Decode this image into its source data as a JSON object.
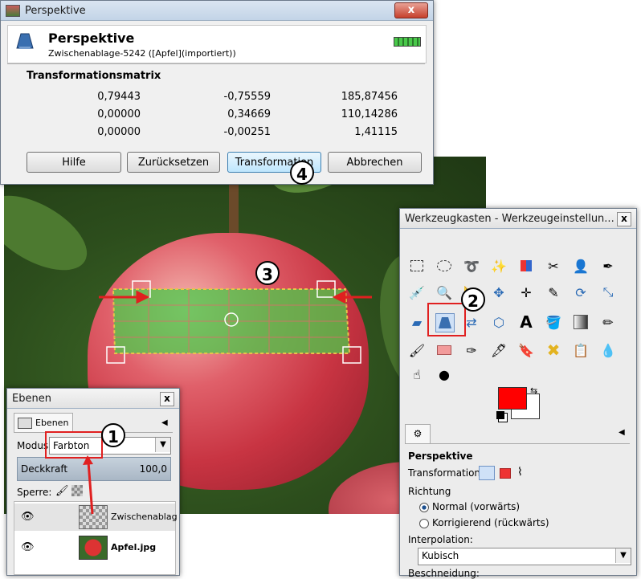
{
  "perspective_dialog": {
    "window_title": "Perspektive",
    "heading": "Perspektive",
    "subtitle": "Zwischenablage-5242 ([Apfel](importiert))",
    "section_title": "Transformationsmatrix",
    "matrix": [
      [
        "0,79443",
        "-0,75559",
        "185,87456"
      ],
      [
        "0,00000",
        "0,34669",
        "110,14286"
      ],
      [
        "0,00000",
        "-0,00251",
        "1,41115"
      ]
    ],
    "buttons": {
      "help": "Hilfe",
      "reset": "Zurücksetzen",
      "transform": "Transformation",
      "cancel": "Abbrechen"
    },
    "close_label": "x"
  },
  "toolbox": {
    "window_title": "Werkzeugkasten - Werkzeugeinstellun...",
    "close_label": "x",
    "options": {
      "title": "Perspektive",
      "transformation_label": "Transformation:",
      "direction_label": "Richtung",
      "direction_normal": "Normal (vorwärts)",
      "direction_corrective": "Korrigierend (rückwärts)",
      "interpolation_label": "Interpolation:",
      "interpolation_value": "Kubisch",
      "clipping_label": "Beschneidung:"
    },
    "colors": {
      "foreground": "#ff0000",
      "background": "#ffffff"
    }
  },
  "layers_panel": {
    "window_title": "Ebenen",
    "close_label": "x",
    "tab_label": "Ebenen",
    "mode_label": "Modus",
    "mode_value": "Farbton",
    "opacity_label": "Deckkraft",
    "opacity_value": "100,0",
    "lock_label": "Sperre:",
    "layers": [
      {
        "name": "Zwischenablag"
      },
      {
        "name": "Apfel.jpg"
      }
    ]
  },
  "markers": [
    "1",
    "2",
    "3",
    "4"
  ],
  "accent_colors": {
    "annotation_red": "#e02020",
    "grid_green": "#49c94a"
  }
}
